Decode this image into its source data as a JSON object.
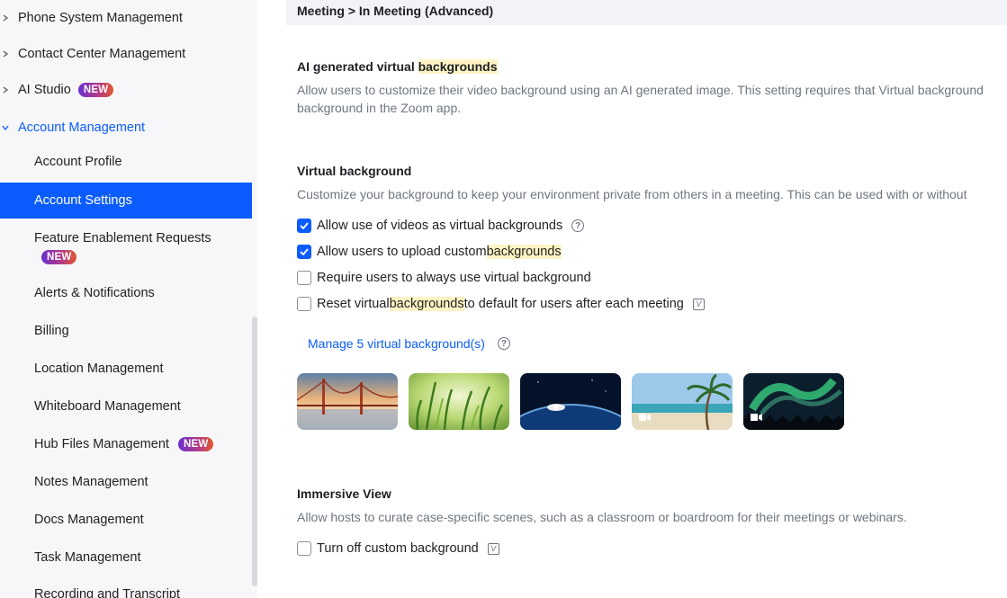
{
  "sidebar": {
    "groups": [
      {
        "label": "Phone System Management"
      },
      {
        "label": "Contact Center Management"
      },
      {
        "label": "AI Studio",
        "badge": "NEW"
      },
      {
        "label": "Account Management"
      }
    ],
    "items": [
      {
        "label": "Account Profile"
      },
      {
        "label": "Account Settings"
      },
      {
        "label": "Feature Enablement Requests",
        "badge": "NEW"
      },
      {
        "label": "Alerts & Notifications"
      },
      {
        "label": "Billing"
      },
      {
        "label": "Location Management"
      },
      {
        "label": "Whiteboard Management"
      },
      {
        "label": "Hub Files Management",
        "badge": "NEW"
      },
      {
        "label": "Notes Management"
      },
      {
        "label": "Docs Management"
      },
      {
        "label": "Task Management"
      },
      {
        "label": "Recording and Transcript"
      }
    ]
  },
  "main": {
    "breadcrumb": "Meeting > In Meeting (Advanced)",
    "ai_bg": {
      "title_pre": "AI generated virtual ",
      "title_hl": "backgrounds",
      "desc_line1": "Allow users to customize their video background using an AI generated image. This setting requires that Virtual background",
      "desc_line2": "background in the Zoom app."
    },
    "virtual_bg": {
      "title": "Virtual background",
      "desc": "Customize your background to keep your environment private from others in a meeting. This can be used with or without",
      "options": [
        {
          "pre": "Allow use of videos as virtual backgrounds",
          "hl": "",
          "post": "",
          "checked": true
        },
        {
          "pre": "Allow users to upload custom ",
          "hl": "backgrounds",
          "post": "",
          "checked": true
        },
        {
          "pre": "Require users to always use virtual background",
          "hl": "",
          "post": "",
          "checked": false
        },
        {
          "pre": "Reset virtual ",
          "hl": "backgrounds",
          "post": " to default for users after each meeting",
          "checked": false
        }
      ],
      "manage_link": "Manage 5 virtual background(s)"
    },
    "immersive": {
      "title": "Immersive View",
      "desc": "Allow hosts to curate case-specific scenes, such as a classroom or boardroom for their meetings or webinars.",
      "option": "Turn off custom background"
    }
  },
  "colors": {
    "accent": "#0b5cff",
    "highlight": "#fff3c4",
    "sidebar_bg": "#f7f7fa"
  }
}
